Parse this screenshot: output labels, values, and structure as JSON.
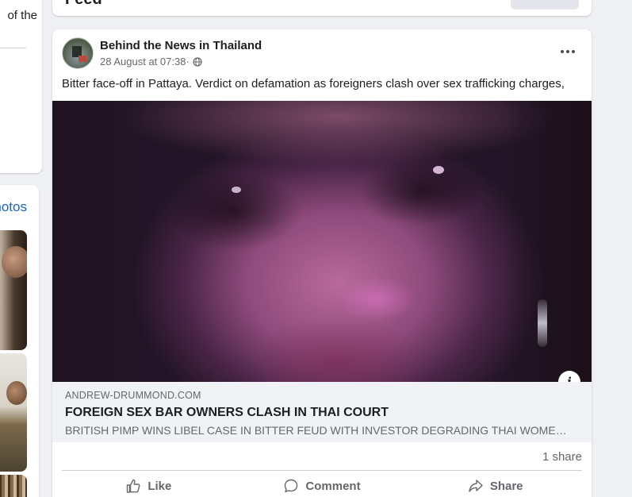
{
  "left_column": {
    "top_text": "of the",
    "photos_link": "Photos"
  },
  "top_card": {
    "title": "Feed"
  },
  "post": {
    "page_name": "Behind the News in Thailand",
    "timestamp": "28 August at 07:38",
    "separator": " · ",
    "audience_icon": "globe-icon",
    "more_icon": "more-options-icon",
    "text": "Bitter face-off in Pattaya. Verdict on defamation as foreigners clash over sex trafficking charges,",
    "link_preview": {
      "domain": "ANDREW-DRUMMOND.COM",
      "title": "FOREIGN SEX BAR OWNERS CLASH IN THAI COURT",
      "description": "BRITISH PIMP WINS LIBEL CASE IN BITTER FEUD WITH INVESTOR DEGRADING THAI WOMEN ...",
      "info_glyph": "i"
    },
    "share_count": "1 share",
    "actions": {
      "like": "Like",
      "comment": "Comment",
      "share": "Share"
    }
  },
  "colors": {
    "background": "#eef0f3",
    "card": "#ffffff",
    "link_blue": "#1b64c4",
    "secondary_text": "#65676b",
    "preview_bg": "#f0f2f5"
  }
}
